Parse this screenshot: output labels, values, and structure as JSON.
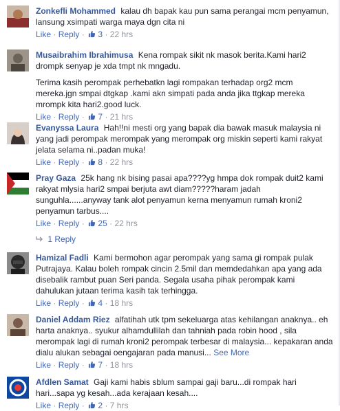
{
  "comments": [
    {
      "author": "Zonkefli Mohammed",
      "paragraphs": [
        "kalau dh bapak kau pun sama perangai mcm penyamun, lansung xsimpati warga maya dgn cita ni"
      ],
      "like_label": "Like",
      "reply_label": "Reply",
      "likes": "3",
      "time": "22 hrs",
      "avatar_color": "#8a2e2e"
    },
    {
      "author": "Musaibrahim Ibrahimusa",
      "paragraphs": [
        "Kena rompak sikit nk masok berita.Kami hari2 drompk senyap je xda tmpt nk mngadu.",
        "Terima kasih perompak perhebatkn lagi rompakan terhadap org2 mcm mereka.jgn smpai dtgkap .kami akn simpati pada anda jika ttgkap mereka mrompk kita hari2.good luck."
      ],
      "like_label": "Like",
      "reply_label": "Reply",
      "likes": "7",
      "time": "21 hrs",
      "avatar_color": "#6b6358"
    },
    {
      "author": "Evanyssa Laura",
      "paragraphs": [
        "Hah!!ni mesti org yang bapak dia bawak masuk malaysia ni yang jadi perompak merompak yang merompak org miskin seperti kami rakyat jelata selama ni..padan muka!"
      ],
      "like_label": "Like",
      "reply_label": "Reply",
      "likes": "8",
      "time": "22 hrs",
      "avatar_color": "#3a3030"
    },
    {
      "author": "Pray Gaza",
      "paragraphs": [
        "25k hang nk bising pasai apa????yg hmpa dok rompak duit2 kami rakyat mlysia hari2 smpai berjuta awt diam?????haram jadah sunguhla......anyway tank alot penyamun kerna menyamun rumah kroni2 penyamun tarbus...."
      ],
      "like_label": "Like",
      "reply_label": "Reply",
      "likes": "25",
      "time": "22 hrs",
      "avatar_color": "#2e7d32"
    },
    {
      "author": "Hamizal Fadli",
      "paragraphs": [
        "Kami bermohon agar perompak yang sama gi rompak pulak Putrajaya. Kalau boleh rompak cincin 2.5mil dan memdedahkan apa yang ada disebalik rambut puan Seri panda. Segala usaha pihak perompak kami dahulukan jutaan terima kasih tak terhingga."
      ],
      "like_label": "Like",
      "reply_label": "Reply",
      "likes": "4",
      "time": "18 hrs",
      "avatar_color": "#2a2a2a"
    },
    {
      "author": "Daniel Addam Riez",
      "paragraphs": [
        "alfatihah utk tpm sekeluarga atas kehilangan anaknya.. eh harta anaknya.. syukur alhamdullilah dan tahniah pada robin hood , sila merompak lagi di rumah kroni2 perompak terbesar di malaysia... kepakaran anda dialu alukan sebagai oengajaran pada manusi..."
      ],
      "see_more": "See More",
      "like_label": "Like",
      "reply_label": "Reply",
      "likes": "7",
      "time": "18 hrs",
      "avatar_color": "#7a5a4a"
    },
    {
      "author": "Afdlen Samat",
      "paragraphs": [
        "Gaji kami habis sblum sampai gaji baru...di rompak hari hari...sapa yg kesah...ada kerajaan kesah...."
      ],
      "like_label": "Like",
      "reply_label": "Reply",
      "likes": "2",
      "time": "7 hrs",
      "avatar_color": "#0d47a1"
    }
  ],
  "replies_link": "1 Reply",
  "separator": "·"
}
